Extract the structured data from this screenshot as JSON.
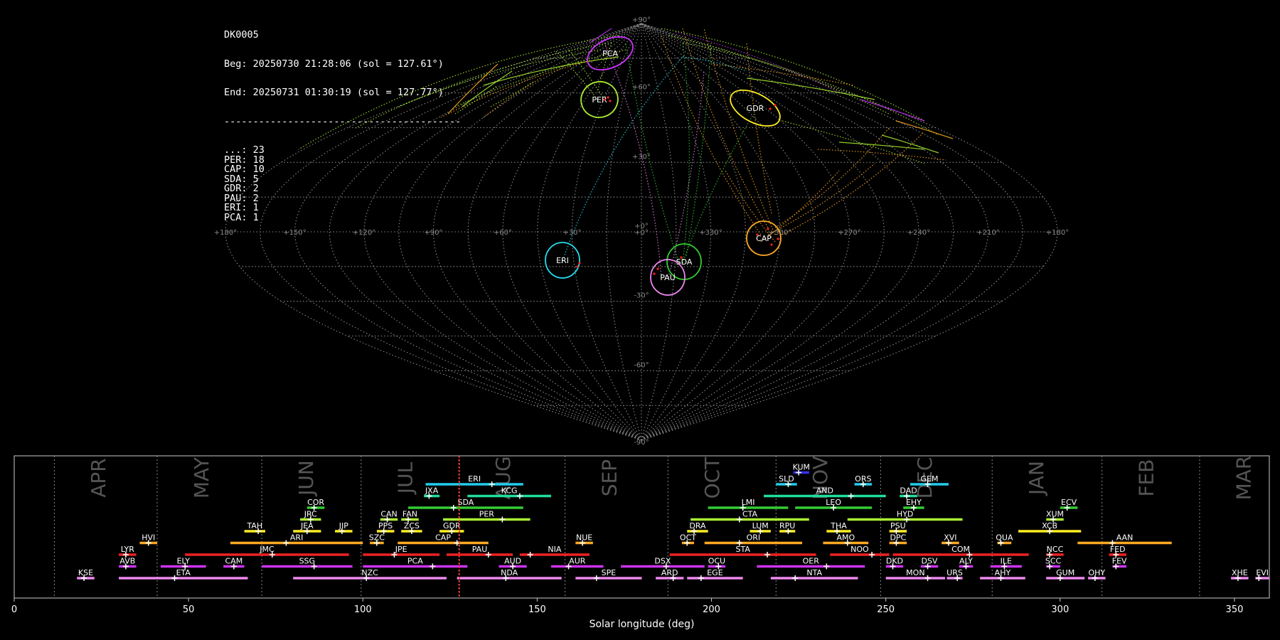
{
  "info": {
    "station": "DK0005",
    "beg": "Beg: 20250730 21:28:06 (sol = 127.61°)",
    "end": "End: 20250731 01:30:19 (sol = 127.77°)",
    "separator": "-----------------------------------------",
    "counts": [
      {
        "code": "...",
        "n": 23
      },
      {
        "code": "PER",
        "n": 18
      },
      {
        "code": "CAP",
        "n": 10
      },
      {
        "code": "SDA",
        "n": 5
      },
      {
        "code": "GDR",
        "n": 2
      },
      {
        "code": "PAU",
        "n": 2
      },
      {
        "code": "ERI",
        "n": 1
      },
      {
        "code": "PCA",
        "n": 1
      }
    ]
  },
  "chart_data": [
    {
      "type": "scatter",
      "projection": "sinusoidal",
      "meridian_labels": [
        "+180°",
        "+150°",
        "+120°",
        "+90°",
        "+60°",
        "+30°",
        "+0°",
        "+330°",
        "+300°",
        "+270°",
        "+240°",
        "+210°",
        "+180°"
      ],
      "parallel_labels": [
        "+90°",
        "+60°",
        "+30°",
        "+0°",
        "-30°",
        "-60°",
        "-90°"
      ],
      "showers": [
        {
          "code": "PCA",
          "lam": -36,
          "beta": 73,
          "color": "#cc33ff"
        },
        {
          "code": "PER",
          "lam": -48,
          "beta": 55,
          "color": "#aaee33"
        },
        {
          "code": "GDR",
          "lam": -60,
          "beta": 51,
          "color": "#ffee22"
        },
        {
          "code": "CAP",
          "lam": -60,
          "beta": -3,
          "color": "#ffaa22"
        },
        {
          "code": "SDA",
          "lam": -15,
          "beta": -12,
          "color": "#33cc33"
        },
        {
          "code": "PAU",
          "lam": -10,
          "beta": -19,
          "color": "#ee88ee"
        },
        {
          "code": "ERI",
          "lam": 27,
          "beta": -12,
          "color": "#22ddee"
        }
      ]
    },
    {
      "type": "bar",
      "xlabel": "Solar longitude (deg)",
      "xlim": [
        0,
        360
      ],
      "xticks": [
        0,
        50,
        100,
        150,
        200,
        250,
        300,
        350
      ],
      "current_sol": 127.7,
      "months": [
        {
          "name": "APR",
          "start": 11.5,
          "mid": 24.5
        },
        {
          "name": "MAY",
          "start": 41,
          "mid": 54
        },
        {
          "name": "JUN",
          "start": 71,
          "mid": 84
        },
        {
          "name": "JUL",
          "start": 99.5,
          "mid": 112.5
        },
        {
          "name": "AUG",
          "start": 127.5,
          "mid": 140.5
        },
        {
          "name": "SEP",
          "start": 158,
          "mid": 171
        },
        {
          "name": "OCT",
          "start": 187.5,
          "mid": 200.5
        },
        {
          "name": "NOV",
          "start": 218.5,
          "mid": 231.5
        },
        {
          "name": "DEC",
          "start": 248.5,
          "mid": 261.5
        },
        {
          "name": "JAN",
          "start": 280.5,
          "mid": 293.5
        },
        {
          "name": "FEB",
          "start": 312,
          "mid": 325
        },
        {
          "name": "MAR",
          "start": 340,
          "mid": 353
        }
      ],
      "showers": [
        {
          "code": "KUM",
          "start": 223.5,
          "end": 228,
          "peak": 225,
          "row": 11,
          "color": "#3333ff"
        },
        {
          "code": "ERI",
          "start": 118,
          "end": 146,
          "peak": 137,
          "row": 10,
          "color": "#22ccee"
        },
        {
          "code": "SLD",
          "start": 218.5,
          "end": 224.5,
          "peak": 222,
          "row": 10,
          "color": "#22ccee"
        },
        {
          "code": "ORS",
          "start": 241,
          "end": 246,
          "peak": 243.5,
          "row": 10,
          "color": "#22ccee"
        },
        {
          "code": "GEM",
          "start": 257,
          "end": 268,
          "peak": 262,
          "row": 10,
          "color": "#22ccee"
        },
        {
          "code": "JXA",
          "start": 117.5,
          "end": 122,
          "peak": 119,
          "row": 9,
          "color": "#22dd99"
        },
        {
          "code": "KCG",
          "start": 130,
          "end": 154,
          "peak": 145,
          "row": 9,
          "color": "#22dd99"
        },
        {
          "code": "AND",
          "start": 215,
          "end": 250,
          "peak": 240,
          "row": 9,
          "color": "#22dd99"
        },
        {
          "code": "DAD",
          "start": 254,
          "end": 259,
          "peak": 256,
          "row": 9,
          "color": "#22dd99"
        },
        {
          "code": "COR",
          "start": 84,
          "end": 89,
          "peak": 86,
          "row": 8,
          "color": "#33cc33"
        },
        {
          "code": "SDA",
          "start": 113,
          "end": 146,
          "peak": 126,
          "row": 8,
          "color": "#33cc33"
        },
        {
          "code": "LMI",
          "start": 199,
          "end": 222,
          "peak": 209,
          "row": 8,
          "color": "#33cc33"
        },
        {
          "code": "LEO",
          "start": 224,
          "end": 246,
          "peak": 235,
          "row": 8,
          "color": "#33cc33"
        },
        {
          "code": "EHY",
          "start": 255,
          "end": 261,
          "peak": 258,
          "row": 8,
          "color": "#33cc33"
        },
        {
          "code": "ECV",
          "start": 300,
          "end": 305,
          "peak": 302,
          "row": 8,
          "color": "#33cc33"
        },
        {
          "code": "JRC",
          "start": 82,
          "end": 88,
          "peak": 85,
          "row": 7,
          "color": "#aaee33"
        },
        {
          "code": "CAN",
          "start": 105,
          "end": 110,
          "peak": 107,
          "row": 7,
          "color": "#aaee33"
        },
        {
          "code": "FAN",
          "start": 111,
          "end": 116,
          "peak": 113,
          "row": 7,
          "color": "#aaee33"
        },
        {
          "code": "PER",
          "start": 123,
          "end": 148,
          "peak": 140,
          "row": 7,
          "color": "#aaee33"
        },
        {
          "code": "CTA",
          "start": 194,
          "end": 228,
          "peak": 208,
          "row": 7,
          "color": "#aaee33"
        },
        {
          "code": "HYD",
          "start": 239,
          "end": 272,
          "peak": 256,
          "row": 7,
          "color": "#aaee33"
        },
        {
          "code": "XUM",
          "start": 296,
          "end": 301,
          "peak": 298,
          "row": 7,
          "color": "#aaee33"
        },
        {
          "code": "TAH",
          "start": 66,
          "end": 72,
          "peak": 70,
          "row": 6,
          "color": "#ffee22"
        },
        {
          "code": "JEA",
          "start": 80,
          "end": 88,
          "peak": 84,
          "row": 6,
          "color": "#ffee22"
        },
        {
          "code": "JIP",
          "start": 92,
          "end": 97,
          "peak": 94,
          "row": 6,
          "color": "#ffee22"
        },
        {
          "code": "PPS",
          "start": 104,
          "end": 109,
          "peak": 106,
          "row": 6,
          "color": "#ffee22"
        },
        {
          "code": "ZCS",
          "start": 111,
          "end": 117,
          "peak": 114,
          "row": 6,
          "color": "#ffee22"
        },
        {
          "code": "GDR",
          "start": 122,
          "end": 129,
          "peak": 125.5,
          "row": 6,
          "color": "#ffee22"
        },
        {
          "code": "DRA",
          "start": 193,
          "end": 199,
          "peak": 195,
          "row": 6,
          "color": "#ffee22"
        },
        {
          "code": "LUM",
          "start": 211,
          "end": 217,
          "peak": 214,
          "row": 6,
          "color": "#ffee22"
        },
        {
          "code": "RPU",
          "start": 219.5,
          "end": 224,
          "peak": 222,
          "row": 6,
          "color": "#ffee22"
        },
        {
          "code": "THA",
          "start": 233,
          "end": 240,
          "peak": 236,
          "row": 6,
          "color": "#ffee22"
        },
        {
          "code": "PSU",
          "start": 251,
          "end": 256,
          "peak": 253,
          "row": 6,
          "color": "#ffee22"
        },
        {
          "code": "XCB",
          "start": 288,
          "end": 306,
          "peak": 297,
          "row": 6,
          "color": "#ffee22"
        },
        {
          "code": "HVI",
          "start": 36,
          "end": 41,
          "peak": 38.5,
          "row": 5,
          "color": "#ffaa22"
        },
        {
          "code": "ARI",
          "start": 62,
          "end": 100,
          "peak": 78,
          "row": 5,
          "color": "#ffaa22"
        },
        {
          "code": "SZC",
          "start": 102,
          "end": 106,
          "peak": 104,
          "row": 5,
          "color": "#ffaa22"
        },
        {
          "code": "CAP",
          "start": 110,
          "end": 136,
          "peak": 127,
          "row": 5,
          "color": "#ffaa22"
        },
        {
          "code": "NUE",
          "start": 161,
          "end": 166,
          "peak": 163,
          "row": 5,
          "color": "#ffaa22"
        },
        {
          "code": "OCT",
          "start": 191.5,
          "end": 195,
          "peak": 193,
          "row": 5,
          "color": "#ffaa22"
        },
        {
          "code": "ORI",
          "start": 198,
          "end": 226,
          "peak": 208,
          "row": 5,
          "color": "#ffaa22"
        },
        {
          "code": "AMO",
          "start": 232,
          "end": 245,
          "peak": 239,
          "row": 5,
          "color": "#ffaa22"
        },
        {
          "code": "DPC",
          "start": 251,
          "end": 256,
          "peak": 253,
          "row": 5,
          "color": "#ffaa22"
        },
        {
          "code": "XVI",
          "start": 266,
          "end": 271,
          "peak": 268,
          "row": 5,
          "color": "#ffaa22"
        },
        {
          "code": "QUA",
          "start": 282,
          "end": 286,
          "peak": 283,
          "row": 5,
          "color": "#ffaa22"
        },
        {
          "code": "AAN",
          "start": 305,
          "end": 332,
          "peak": 315,
          "row": 5,
          "color": "#ffaa22"
        },
        {
          "code": "LYR",
          "start": 30,
          "end": 35,
          "peak": 32,
          "row": 4,
          "color": "#ee2222"
        },
        {
          "code": "JMC",
          "start": 49,
          "end": 96,
          "peak": 74,
          "row": 4,
          "color": "#ee2222"
        },
        {
          "code": "JPE",
          "start": 100,
          "end": 122,
          "peak": 109,
          "row": 4,
          "color": "#ee2222"
        },
        {
          "code": "PAU",
          "start": 124,
          "end": 143,
          "peak": 136,
          "row": 4,
          "color": "#ee2222"
        },
        {
          "code": "NIA",
          "start": 145,
          "end": 165,
          "peak": 148,
          "row": 4,
          "color": "#ee2222"
        },
        {
          "code": "STA",
          "start": 188,
          "end": 230,
          "peak": 216,
          "row": 4,
          "color": "#ee2222"
        },
        {
          "code": "NOO",
          "start": 234,
          "end": 251,
          "peak": 246,
          "row": 4,
          "color": "#ee2222"
        },
        {
          "code": "COM",
          "start": 252,
          "end": 291,
          "peak": 274,
          "row": 4,
          "color": "#ee2222"
        },
        {
          "code": "NCC",
          "start": 296,
          "end": 301,
          "peak": 297,
          "row": 4,
          "color": "#ee2222"
        },
        {
          "code": "FED",
          "start": 314,
          "end": 319,
          "peak": 316,
          "row": 4,
          "color": "#ee2222"
        },
        {
          "code": "AVB",
          "start": 30,
          "end": 35,
          "peak": 32,
          "row": 3,
          "color": "#cc33ee"
        },
        {
          "code": "ELY",
          "start": 42,
          "end": 55,
          "peak": 49,
          "row": 3,
          "color": "#cc33ee"
        },
        {
          "code": "CAM",
          "start": 60,
          "end": 66,
          "peak": 63,
          "row": 3,
          "color": "#cc33ee"
        },
        {
          "code": "SSG",
          "start": 71,
          "end": 97,
          "peak": 86,
          "row": 3,
          "color": "#cc33ee"
        },
        {
          "code": "PCA",
          "start": 100,
          "end": 130,
          "peak": 120,
          "row": 3,
          "color": "#cc33ee"
        },
        {
          "code": "AUD",
          "start": 139,
          "end": 147,
          "peak": 143,
          "row": 3,
          "color": "#cc33ee"
        },
        {
          "code": "AUR",
          "start": 154,
          "end": 169,
          "peak": 159,
          "row": 3,
          "color": "#cc33ee"
        },
        {
          "code": "DSX",
          "start": 174,
          "end": 198,
          "peak": 187,
          "row": 3,
          "color": "#cc33ee"
        },
        {
          "code": "OCU",
          "start": 199,
          "end": 204,
          "peak": 202,
          "row": 3,
          "color": "#cc33ee"
        },
        {
          "code": "OER",
          "start": 213,
          "end": 244,
          "peak": 233,
          "row": 3,
          "color": "#cc33ee"
        },
        {
          "code": "DKD",
          "start": 250,
          "end": 255,
          "peak": 252,
          "row": 3,
          "color": "#cc33ee"
        },
        {
          "code": "DSV",
          "start": 260,
          "end": 265,
          "peak": 262,
          "row": 3,
          "color": "#cc33ee"
        },
        {
          "code": "ALY",
          "start": 271,
          "end": 275,
          "peak": 273,
          "row": 3,
          "color": "#cc33ee"
        },
        {
          "code": "ILE",
          "start": 280,
          "end": 289,
          "peak": 284,
          "row": 3,
          "color": "#cc33ee"
        },
        {
          "code": "SCC",
          "start": 296,
          "end": 300,
          "peak": 297,
          "row": 3,
          "color": "#cc33ee"
        },
        {
          "code": "FEV",
          "start": 315,
          "end": 319,
          "peak": 316,
          "row": 3,
          "color": "#cc33ee"
        },
        {
          "code": "KSE",
          "start": 18,
          "end": 23,
          "peak": 20,
          "row": 2,
          "color": "#ee88ee"
        },
        {
          "code": "ETA",
          "start": 30,
          "end": 67,
          "peak": 46,
          "row": 2,
          "color": "#ee88ee"
        },
        {
          "code": "NZC",
          "start": 80,
          "end": 124,
          "peak": 101,
          "row": 2,
          "color": "#ee88ee"
        },
        {
          "code": "NDA",
          "start": 127,
          "end": 157,
          "peak": 141,
          "row": 2,
          "color": "#ee88ee"
        },
        {
          "code": "SPE",
          "start": 161,
          "end": 180,
          "peak": 167,
          "row": 2,
          "color": "#ee88ee"
        },
        {
          "code": "ARD",
          "start": 184,
          "end": 192,
          "peak": 189,
          "row": 2,
          "color": "#ee88ee"
        },
        {
          "code": "EGE",
          "start": 193,
          "end": 209,
          "peak": 197,
          "row": 2,
          "color": "#ee88ee"
        },
        {
          "code": "NTA",
          "start": 217,
          "end": 242,
          "peak": 224,
          "row": 2,
          "color": "#ee88ee"
        },
        {
          "code": "MON",
          "start": 250,
          "end": 267,
          "peak": 262,
          "row": 2,
          "color": "#ee88ee"
        },
        {
          "code": "URS",
          "start": 267.5,
          "end": 272,
          "peak": 270.5,
          "row": 2,
          "color": "#ee88ee"
        },
        {
          "code": "AHY",
          "start": 277,
          "end": 290,
          "peak": 283,
          "row": 2,
          "color": "#ee88ee"
        },
        {
          "code": "GUM",
          "start": 296,
          "end": 307,
          "peak": 300,
          "row": 2,
          "color": "#ee88ee"
        },
        {
          "code": "OHY",
          "start": 308,
          "end": 313,
          "peak": 310,
          "row": 2,
          "color": "#ee88ee"
        },
        {
          "code": "XHE",
          "start": 349,
          "end": 354,
          "peak": 351,
          "row": 2,
          "color": "#ee88ee"
        },
        {
          "code": "EVI",
          "start": 356,
          "end": 360,
          "peak": 357,
          "row": 2,
          "color": "#ee88ee"
        }
      ]
    }
  ]
}
